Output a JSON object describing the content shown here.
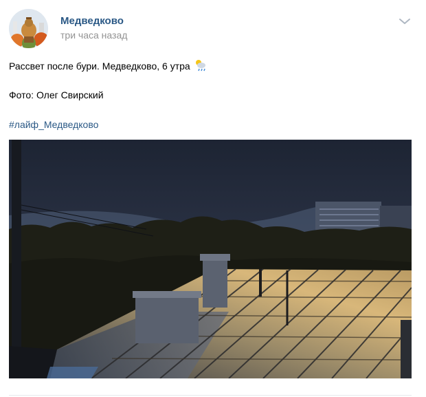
{
  "post": {
    "author": "Медведково",
    "time": "три часа назад",
    "text_line1": "Рассвет после бури. Медведково, 6 утра",
    "text_line2": "Фото: Олег Свирский",
    "hashtag": "#лайф_Медведково"
  },
  "icons": {
    "menu": "chevron-down-icon",
    "emoji": "sun-behind-rain-cloud-emoji"
  },
  "colors": {
    "link": "#2a5885",
    "secondary_text": "#939393",
    "divider": "#e7e8ec"
  }
}
